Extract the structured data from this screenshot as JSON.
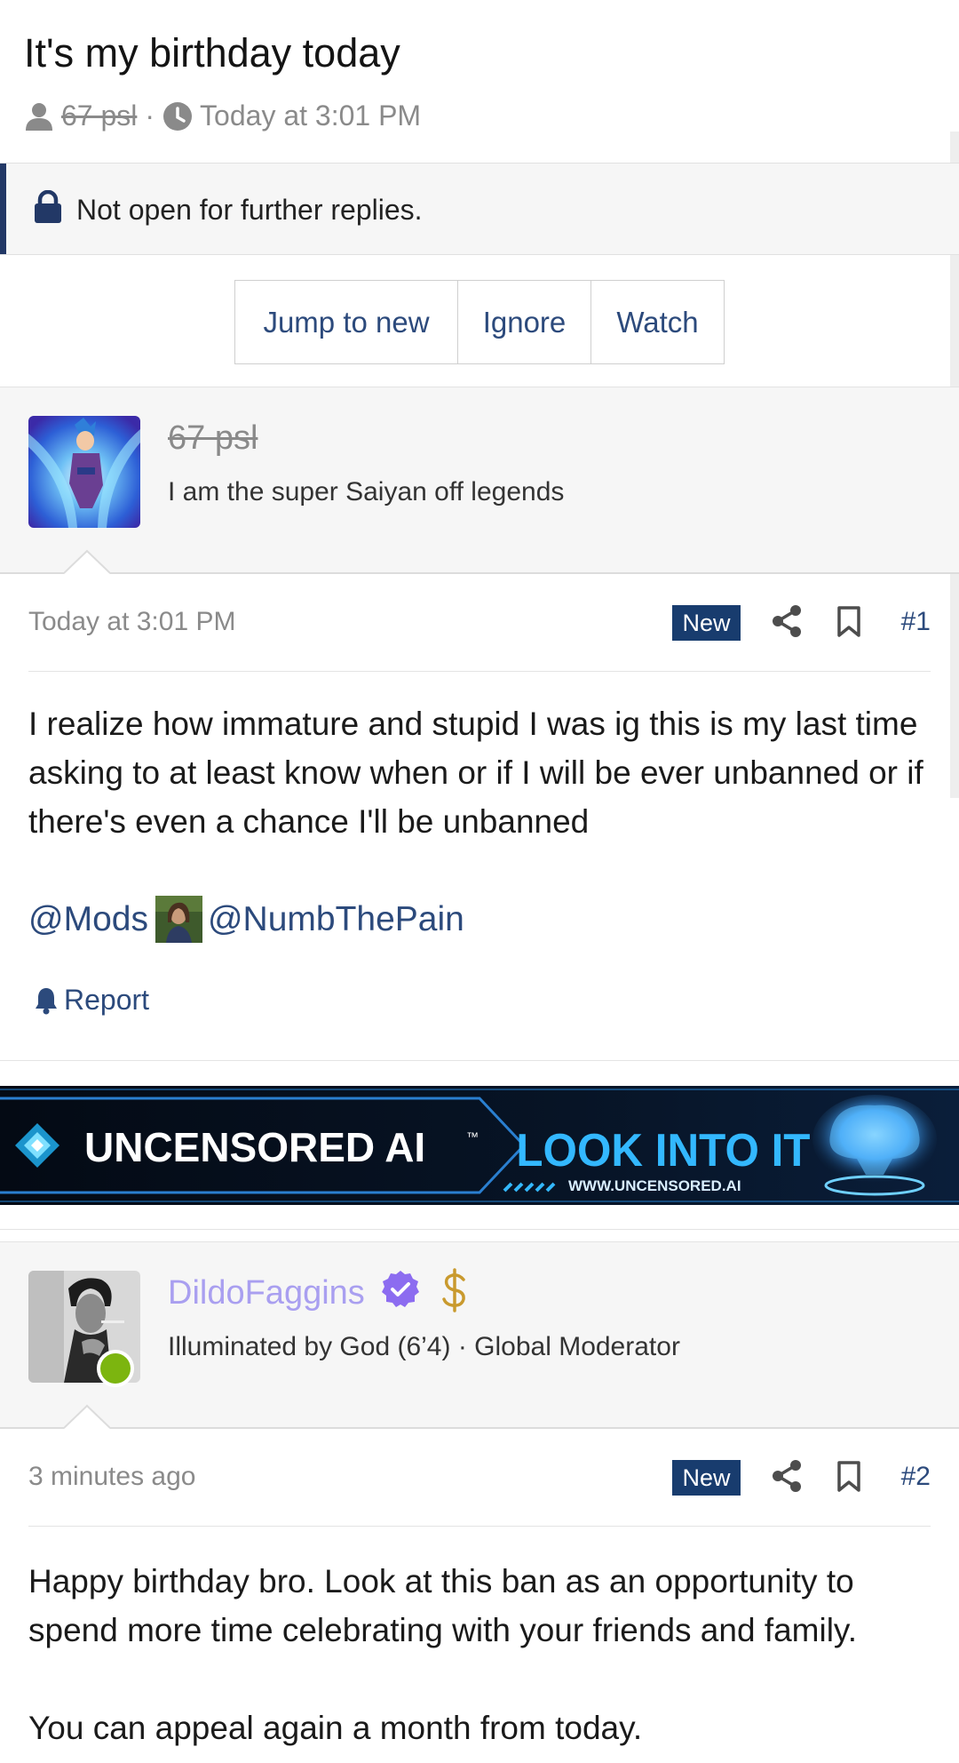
{
  "thread": {
    "title": "It's my birthday today",
    "author": "67 psl",
    "separator": "·",
    "date": "Today at 3:01 PM",
    "locked_notice": "Not open for further replies."
  },
  "actions": {
    "jump_to_new": "Jump to new",
    "ignore": "Ignore",
    "watch": "Watch"
  },
  "posts": [
    {
      "username": "67 psl",
      "user_title": "I am the super Saiyan off legends",
      "date": "Today at 3:01 PM",
      "badge": "New",
      "number": "#1",
      "body": [
        "I realize how immature and stupid I was ig this is my last time asking to at least know when or if I will be ever unbanned or if there's even a chance I'll be unbanned"
      ],
      "mentions": [
        "@Mods",
        "@NumbThePain"
      ],
      "report": "Report"
    },
    {
      "username": "DildoFaggins",
      "user_title": "Illuminated by God (6’4) · Global Moderator",
      "date": "3 minutes ago",
      "badge": "New",
      "number": "#2",
      "body": [
        "Happy birthday bro. Look at this ban as an opportunity to spend more time celebrating with your friends and family.",
        "You can appeal again a month from today."
      ]
    }
  ],
  "ad": {
    "brand": "UNCENSORED AI",
    "trademark": "™",
    "cta": "LOOK INTO IT",
    "url": "WWW.UNCENSORED.AI"
  },
  "icons": {
    "author": "user-icon",
    "date": "clock-icon",
    "lock": "lock-icon",
    "share": "share-icon",
    "bookmark": "bookmark-icon",
    "report": "bell-icon",
    "verified": "verified-check-icon",
    "donor": "dollar-icon"
  },
  "colors": {
    "link": "#2c4a7c",
    "badge_bg": "#183c6e",
    "accent": "#223866",
    "mod_name": "#a99ff0",
    "verified": "#8c6cf0",
    "online": "#7cb50f"
  }
}
